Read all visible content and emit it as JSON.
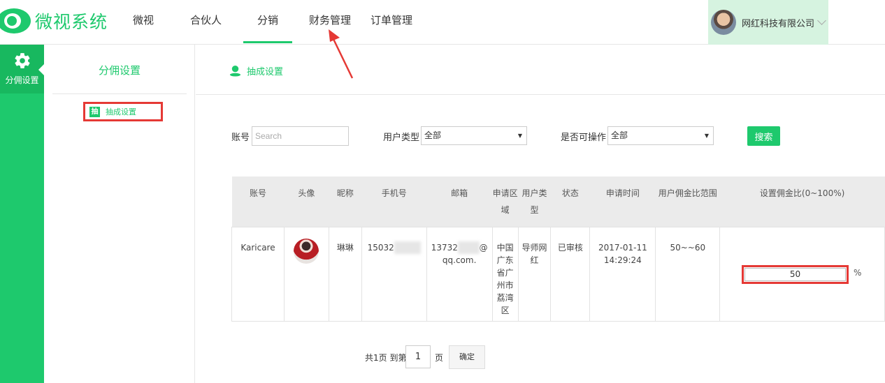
{
  "app": {
    "title": "微视系统"
  },
  "nav": {
    "items": [
      {
        "label": "微视",
        "active": false
      },
      {
        "label": "合伙人",
        "active": false
      },
      {
        "label": "分销",
        "active": true
      },
      {
        "label": "财务管理",
        "active": false
      },
      {
        "label": "订单管理",
        "active": false
      }
    ]
  },
  "user": {
    "name": "网红科技有限公司"
  },
  "sidebar": {
    "items": [
      {
        "label": "分佣设置",
        "icon": "gear-icon"
      }
    ]
  },
  "subpanel": {
    "title": "分佣设置",
    "items": [
      {
        "label": "抽成设置",
        "icon": "抽"
      }
    ]
  },
  "content": {
    "title": "抽成设置"
  },
  "filters": {
    "account_label": "账号",
    "account_placeholder": "Search",
    "user_type_label": "用户类型",
    "user_type_value": "全部",
    "operable_label": "是否可操作",
    "operable_value": "全部",
    "search_button": "搜索"
  },
  "table": {
    "headers": [
      "账号",
      "头像",
      "昵称",
      "手机号",
      "邮箱",
      "申请区域",
      "用户类型",
      "状态",
      "申请时间",
      "用户佣金比范围",
      "设置佣金比(0~100%)"
    ],
    "rows": [
      {
        "account": "Karicare",
        "nickname": "琳琳",
        "phone_visible": "15032",
        "email_visible_1": "13732",
        "email_visible_2": "@",
        "email_visible_3": "qq.com.",
        "region": "中国广东省广州市荔湾区",
        "user_type": "导师网红",
        "status": "已审核",
        "apply_time": "2017-01-11 14:29:24",
        "commission_range": "50~~60",
        "commission_value": "50",
        "percent_sign": "%"
      }
    ]
  },
  "pagination": {
    "total_text": "共1页 到第",
    "page_value": "1",
    "page_unit": "页",
    "confirm_button": "确定"
  },
  "colors": {
    "accent": "#1ec96d",
    "highlight": "#e53935"
  }
}
